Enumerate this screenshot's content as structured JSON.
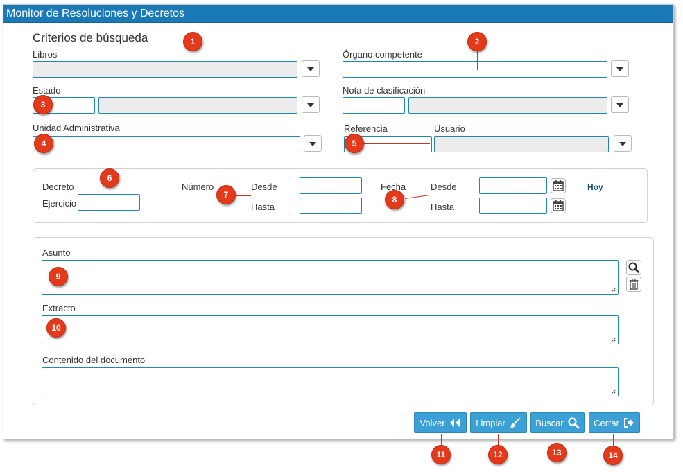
{
  "window": {
    "title": "Monitor de Resoluciones y Decretos"
  },
  "criteria": {
    "heading": "Criterios de búsqueda",
    "libros_label": "Libros",
    "organo_label": "Órgano competente",
    "estado_label": "Estado",
    "nota_label": "Nota de clasificación",
    "unidad_label": "Unidad Administrativa",
    "referencia_label": "Referencia",
    "usuario_label": "Usuario"
  },
  "decreto": {
    "decreto_label": "Decreto",
    "ejercicio_label": "Ejercicio",
    "numero_label": "Número",
    "desde_label": "Desde",
    "hasta_label": "Hasta",
    "fecha_label": "Fecha",
    "fecha_desde_label": "Desde",
    "fecha_hasta_label": "Hasta",
    "hoy_label": "Hoy"
  },
  "content": {
    "asunto_label": "Asunto",
    "extracto_label": "Extracto",
    "contenido_label": "Contenido del documento"
  },
  "actions": {
    "volver": "Volver",
    "limpiar": "Limpiar",
    "buscar": "Buscar",
    "cerrar": "Cerrar"
  },
  "callouts": [
    "1",
    "2",
    "3",
    "4",
    "5",
    "6",
    "7",
    "8",
    "9",
    "10",
    "11",
    "12",
    "13",
    "14"
  ],
  "colors": {
    "titlebar": "#1a7ab7",
    "field_border": "#1e8aa8",
    "button": "#3aa0d5",
    "callout": "#e5391c"
  }
}
